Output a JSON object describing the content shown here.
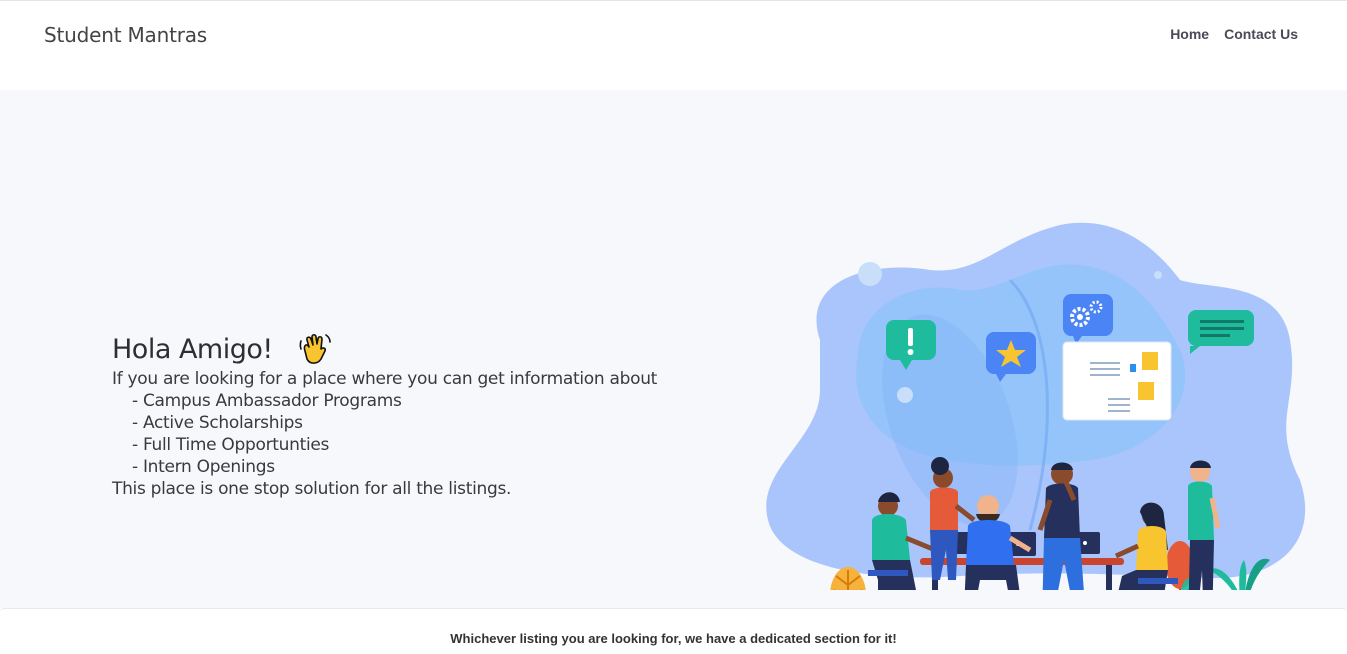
{
  "navbar": {
    "brand": "Student Mantras",
    "links": [
      {
        "label": "Home"
      },
      {
        "label": "Contact Us"
      }
    ]
  },
  "hero": {
    "greeting": "Hola Amigo!",
    "greeting_icon": "waving-hand-icon",
    "intro": "If you are looking for a place where you can get information about",
    "items": [
      "- Campus Ambassador Programs",
      "- Active Scholarships",
      "- Full Time Opportunties",
      "- Intern Openings"
    ],
    "outro": "This place is one stop solution for all the listings.",
    "illustration": "team-meeting-illustration"
  },
  "footer": {
    "tagline": "Whichever listing you are looking for, we have a dedicated section for it!"
  },
  "colors": {
    "hero_background": "#f7f8fc",
    "blob": "#a9c5fb",
    "teal": "#1ebc9c",
    "blue_bubble": "#4a84f5"
  }
}
